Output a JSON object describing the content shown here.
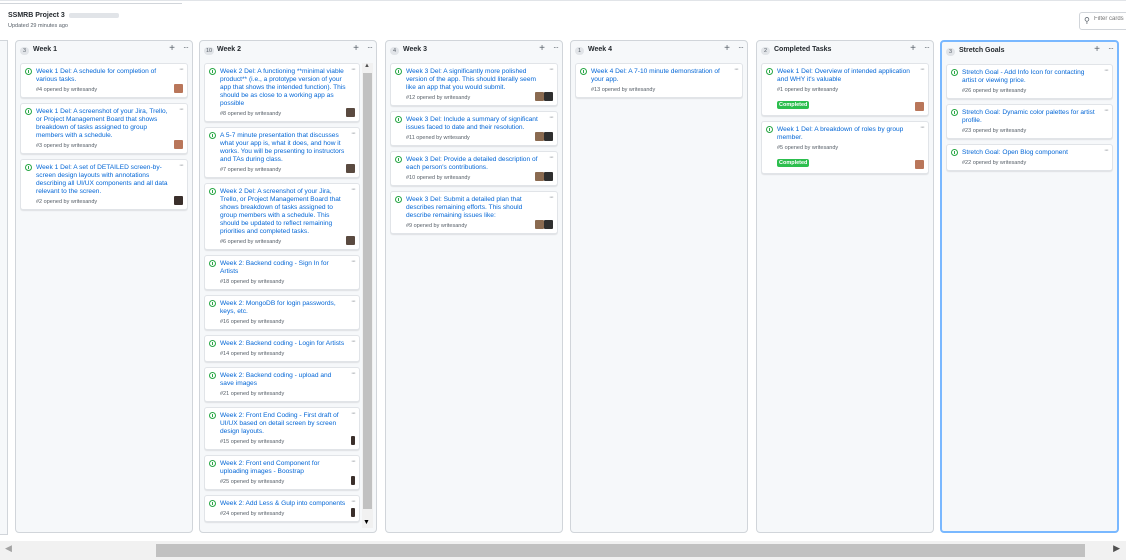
{
  "header": {
    "project_title": "SSMRB Project 3",
    "updated": "Updated 29 minutes ago",
    "filter_placeholder": "Filter cards"
  },
  "colors": {
    "link": "#0366d6",
    "issue_open": "#28a745",
    "label_completed": "#2cbe4e",
    "selected_border": "#79b8ff"
  },
  "columns": [
    {
      "name": "Week 1",
      "count": "3",
      "cards": [
        {
          "title": "Week 1 Del: A schedule for completion of various tasks.",
          "meta": "#4 opened by writesandy"
        },
        {
          "title": "Week 1 Del: A screenshot of your Jira, Trello, or Project Management Board that shows breakdown of tasks assigned to group members with a schedule.",
          "meta": "#3 opened by writesandy"
        },
        {
          "title": "Week 1 Del: A set of DETAILED screen-by-screen design layouts with annotations describing all UI/UX components and all data relevant to the screen.",
          "meta": "#2 opened by writesandy"
        }
      ]
    },
    {
      "name": "Week 2",
      "count": "10",
      "cards": [
        {
          "title": "Week 2 Del: A functioning **minimal viable product** (i.e., a prototype version of your app that shows the intended function). This should be as close to a working app as possible",
          "meta": "#8 opened by writesandy"
        },
        {
          "title": "A 5-7 minute presentation that discusses what your app is, what it does, and how it works. You will be presenting to instructors and TAs during class.",
          "meta": "#7 opened by writesandy"
        },
        {
          "title": "Week 2 Del: A screenshot of your Jira, Trello, or Project Management Board that shows breakdown of tasks assigned to group members with a schedule. This should be updated to reflect remaining priorities and completed tasks.",
          "meta": "#6 opened by writesandy"
        },
        {
          "title": "Week 2: Backend coding - Sign In for Artists",
          "meta": "#18 opened by writesandy"
        },
        {
          "title": "Week 2: MongoDB for login passwords, keys, etc.",
          "meta": "#16 opened by writesandy"
        },
        {
          "title": "Week 2: Backend coding - Login for Artists",
          "meta": "#14 opened by writesandy"
        },
        {
          "title": "Week 2: Backend coding - upload and save images",
          "meta": "#21 opened by writesandy"
        },
        {
          "title": "Week 2: Front End Coding - First draft of UI/UX based on detail screen by screen design layouts.",
          "meta": "#15 opened by writesandy"
        },
        {
          "title": "Week 2: Front end Component for uploading images - Boostrap",
          "meta": "#25 opened by writesandy"
        },
        {
          "title": "Week 2: Add Less & Gulp into components",
          "meta": "#24 opened by writesandy"
        }
      ]
    },
    {
      "name": "Week 3",
      "count": "4",
      "cards": [
        {
          "title": "Week 3 Del: A significantly more polished version of the app. This should literally seem like an app that you would submit.",
          "meta": "#12 opened by writesandy"
        },
        {
          "title": "Week 3 Del: Include a summary of significant issues faced to date and their resolution.",
          "meta": "#11 opened by writesandy"
        },
        {
          "title": "Week 3 Del: Provide a detailed description of each person's contributions.",
          "meta": "#10 opened by writesandy"
        },
        {
          "title": "Week 3 Del: Submit a detailed plan that describes remaining efforts. This should describe remaining issues like:",
          "meta": "#9 opened by writesandy"
        }
      ]
    },
    {
      "name": "Week 4",
      "count": "1",
      "cards": [
        {
          "title": "Week 4 Del: A 7-10 minute demonstration of your app.",
          "meta": "#13 opened by writesandy"
        }
      ]
    },
    {
      "name": "Completed Tasks",
      "count": "2",
      "cards": [
        {
          "title": "Week 1 Del: Overview of intended application and WHY it's valuable",
          "meta": "#1 opened by writesandy",
          "label": "Completed"
        },
        {
          "title": "Week 1 Del: A breakdown of roles by group member.",
          "meta": "#5 opened by writesandy",
          "label": "Completed"
        }
      ]
    },
    {
      "name": "Stretch Goals",
      "count": "3",
      "cards": [
        {
          "title": "Stretch Goal - Add Info Icon for contacting artist or viewing price.",
          "meta": "#26 opened by writesandy"
        },
        {
          "title": "Stretch Goal: Dynamic color palettes for artist profile.",
          "meta": "#23 opened by writesandy"
        },
        {
          "title": "Stretch Goal: Open Blog component",
          "meta": "#22 opened by writesandy"
        }
      ]
    }
  ]
}
